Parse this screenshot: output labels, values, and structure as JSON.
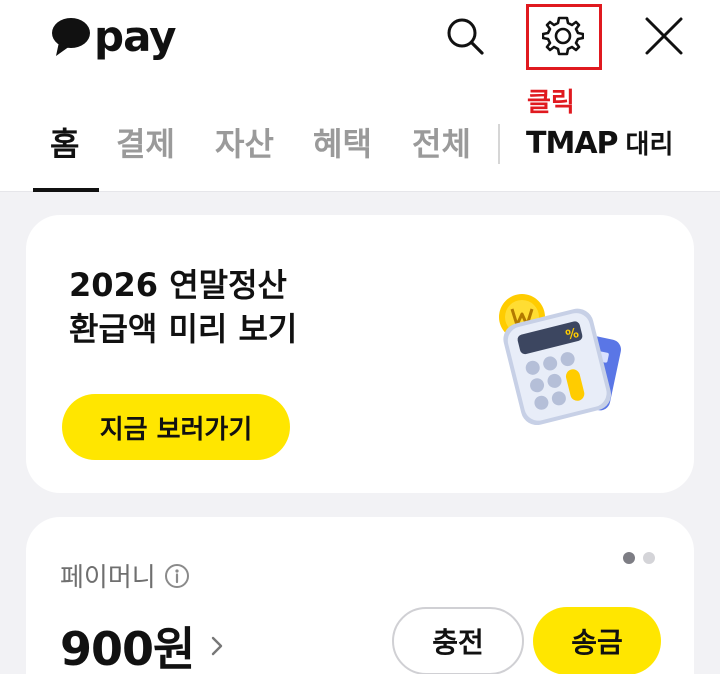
{
  "header": {
    "logo_text": "pay",
    "icons": [
      "search-icon",
      "gear-icon",
      "close-icon"
    ],
    "annotation": "클릭",
    "annotation_color": "#e0191f"
  },
  "tabs": {
    "items": [
      {
        "label": "홈",
        "active": true
      },
      {
        "label": "결제",
        "active": false
      },
      {
        "label": "자산",
        "active": false
      },
      {
        "label": "혜택",
        "active": false
      },
      {
        "label": "전체",
        "active": false
      }
    ],
    "tmap_brand": "TMAP",
    "tmap_sub": "대리"
  },
  "banner": {
    "title_line1": "2026 연말정산",
    "title_line2": "환급액 미리 보기",
    "button_label": "지금 보러가기",
    "illustration": "calculator-coin-card-illustration"
  },
  "money": {
    "label": "페이머니",
    "balance": "900원",
    "charge_label": "충전",
    "send_label": "송금",
    "carousel_pages": 2,
    "carousel_current": 1
  },
  "colors": {
    "accent": "#ffe600",
    "text": "#111111",
    "muted": "#9a9a9a",
    "background": "#f2f2f5"
  }
}
